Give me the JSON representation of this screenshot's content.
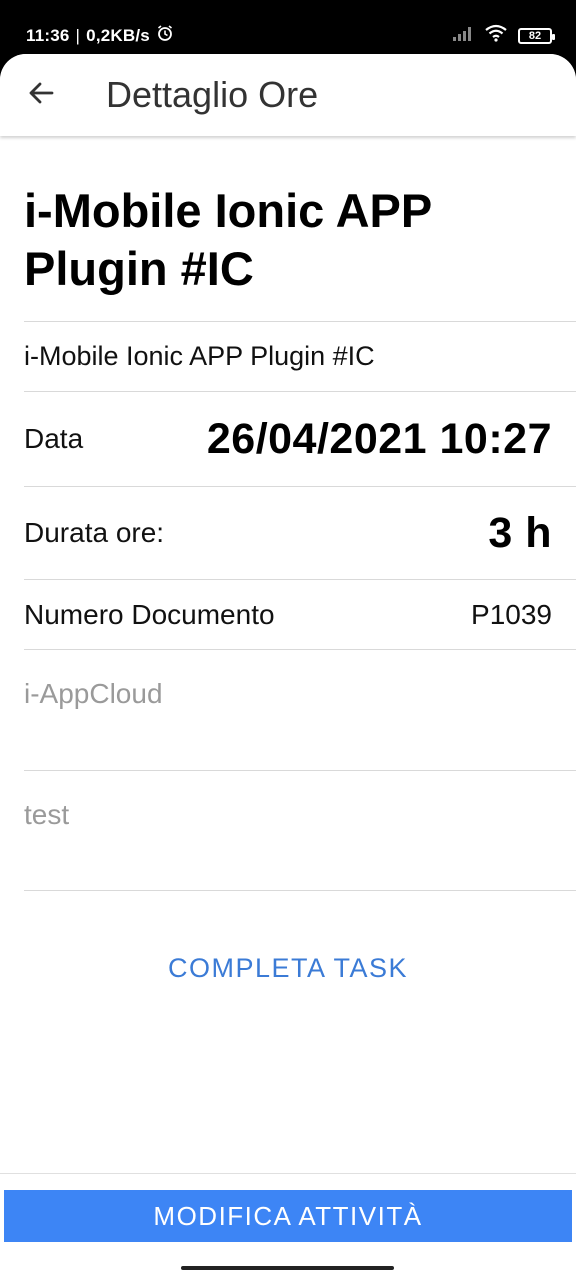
{
  "status_bar": {
    "time": "11:36",
    "net_speed": "0,2KB/s",
    "battery": "82"
  },
  "toolbar": {
    "title": "Dettaglio Ore"
  },
  "task": {
    "title": "i-Mobile Ionic APP Plugin #IC",
    "subtitle": "i-Mobile Ionic APP Plugin #IC",
    "data_label": "Data",
    "data_value": "26/04/2021 10:27",
    "duration_label": "Durata ore:",
    "duration_value": "3 h",
    "doc_label": "Numero Documento",
    "doc_value": "P1039",
    "field1_placeholder": "i-AppCloud",
    "field2_placeholder": "test"
  },
  "actions": {
    "complete_label": "COMPLETA TASK",
    "modify_label": "MODIFICA ATTIVITÀ"
  },
  "colors": {
    "accent": "#3d85f5",
    "link": "#3b7bd6"
  }
}
